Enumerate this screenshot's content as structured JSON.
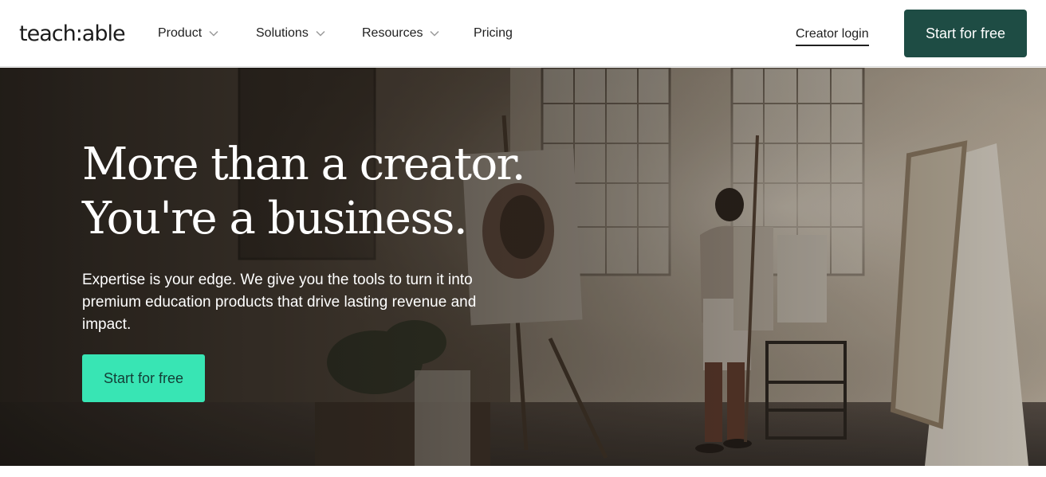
{
  "brand": {
    "logo_text": "teach:able"
  },
  "nav": {
    "items": [
      {
        "label": "Product",
        "has_dropdown": true
      },
      {
        "label": "Solutions",
        "has_dropdown": true
      },
      {
        "label": "Resources",
        "has_dropdown": true
      },
      {
        "label": "Pricing",
        "has_dropdown": false
      }
    ],
    "login_label": "Creator login",
    "cta_label": "Start for free"
  },
  "hero": {
    "headline_line1": "More than a creator.",
    "headline_line2": "You're a business.",
    "subtext": "Expertise is your edge. We give you the tools to turn it into premium education products that drive lasting revenue and impact.",
    "cta_label": "Start for free"
  },
  "colors": {
    "header_cta_bg": "#1e4c44",
    "hero_cta_bg": "#38e5b4",
    "hero_cta_text": "#143d36"
  },
  "icons": {
    "dropdown": "chevron-down-icon"
  }
}
